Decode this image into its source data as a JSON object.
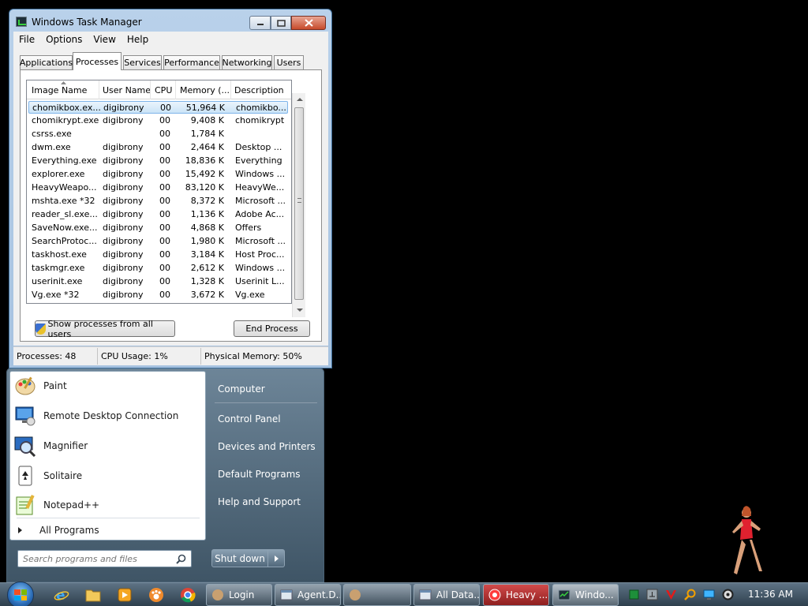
{
  "task_manager": {
    "title": "Windows Task Manager",
    "menu": [
      "File",
      "Options",
      "View",
      "Help"
    ],
    "tabs": [
      "Applications",
      "Processes",
      "Services",
      "Performance",
      "Networking",
      "Users"
    ],
    "active_tab": "Processes",
    "columns": [
      "Image Name",
      "User Name",
      "CPU",
      "Memory (...",
      "Description"
    ],
    "processes": [
      {
        "image": "chomikbox.ex...",
        "user": "digibrony",
        "cpu": "00",
        "memory": "51,964 K",
        "description": "chomikbo...",
        "selected": true
      },
      {
        "image": "chomikrypt.exe",
        "user": "digibrony",
        "cpu": "00",
        "memory": "9,408 K",
        "description": "chomikrypt"
      },
      {
        "image": "csrss.exe",
        "user": "",
        "cpu": "00",
        "memory": "1,784 K",
        "description": ""
      },
      {
        "image": "dwm.exe",
        "user": "digibrony",
        "cpu": "00",
        "memory": "2,464 K",
        "description": "Desktop ..."
      },
      {
        "image": "Everything.exe",
        "user": "digibrony",
        "cpu": "00",
        "memory": "18,836 K",
        "description": "Everything"
      },
      {
        "image": "explorer.exe",
        "user": "digibrony",
        "cpu": "00",
        "memory": "15,492 K",
        "description": "Windows ..."
      },
      {
        "image": "HeavyWeapo...",
        "user": "digibrony",
        "cpu": "00",
        "memory": "83,120 K",
        "description": "HeavyWe..."
      },
      {
        "image": "mshta.exe *32",
        "user": "digibrony",
        "cpu": "00",
        "memory": "8,372 K",
        "description": "Microsoft ..."
      },
      {
        "image": "reader_sl.exe...",
        "user": "digibrony",
        "cpu": "00",
        "memory": "1,136 K",
        "description": "Adobe Ac..."
      },
      {
        "image": "SaveNow.exe...",
        "user": "digibrony",
        "cpu": "00",
        "memory": "4,868 K",
        "description": "Offers"
      },
      {
        "image": "SearchProtoc...",
        "user": "digibrony",
        "cpu": "00",
        "memory": "1,980 K",
        "description": "Microsoft ..."
      },
      {
        "image": "taskhost.exe",
        "user": "digibrony",
        "cpu": "00",
        "memory": "3,184 K",
        "description": "Host Proc..."
      },
      {
        "image": "taskmgr.exe",
        "user": "digibrony",
        "cpu": "00",
        "memory": "2,612 K",
        "description": "Windows ..."
      },
      {
        "image": "userinit.exe",
        "user": "digibrony",
        "cpu": "00",
        "memory": "1,328 K",
        "description": "Userinit L..."
      },
      {
        "image": "Vg.exe *32",
        "user": "digibrony",
        "cpu": "00",
        "memory": "3,672 K",
        "description": "Vg.exe"
      }
    ],
    "show_all_label": "Show processes from all users",
    "end_process_label": "End Process",
    "status": {
      "processes": "Processes: 48",
      "cpu": "CPU Usage: 1%",
      "memory": "Physical Memory: 50%"
    }
  },
  "start_menu": {
    "programs": [
      {
        "label": "Paint",
        "icon": "paint-icon"
      },
      {
        "label": "Remote Desktop Connection",
        "icon": "remote-desktop-icon"
      },
      {
        "label": "Magnifier",
        "icon": "magnifier-icon"
      },
      {
        "label": "Solitaire",
        "icon": "solitaire-icon"
      },
      {
        "label": "Notepad++",
        "icon": "notepad-plus-plus-icon"
      }
    ],
    "all_programs": "All Programs",
    "search_placeholder": "Search programs and files",
    "right_links": [
      "Computer",
      "Control Panel",
      "Devices and Printers",
      "Default Programs",
      "Help and Support"
    ],
    "shutdown_label": "Shut down"
  },
  "taskbar": {
    "pinned": [
      "internet-explorer-icon",
      "folder-icon",
      "media-player-icon",
      "paw-app-icon",
      "chrome-icon"
    ],
    "tasks": [
      {
        "label": "Login",
        "icon": "paw-app-icon"
      },
      {
        "label": "Agent.D...",
        "icon": "window-icon"
      },
      {
        "label": "",
        "icon": "paw-app-icon"
      },
      {
        "label": "All Data...",
        "icon": "window-icon"
      },
      {
        "label": "Heavy ...",
        "icon": "heavy-weapon-icon"
      },
      {
        "label": "Windo...",
        "icon": "task-manager-icon",
        "active": true
      }
    ],
    "tray": [
      "green-square-icon",
      "network-icon",
      "v-icon",
      "search-tray-icon",
      "display-icon",
      "volume-icon"
    ],
    "clock": "11:36 AM"
  },
  "colors": {
    "selection": "#cbe4f7",
    "titlebar": "#b9d1ea",
    "close": "#c74a2b",
    "taskbar": "#2e3f4d"
  }
}
